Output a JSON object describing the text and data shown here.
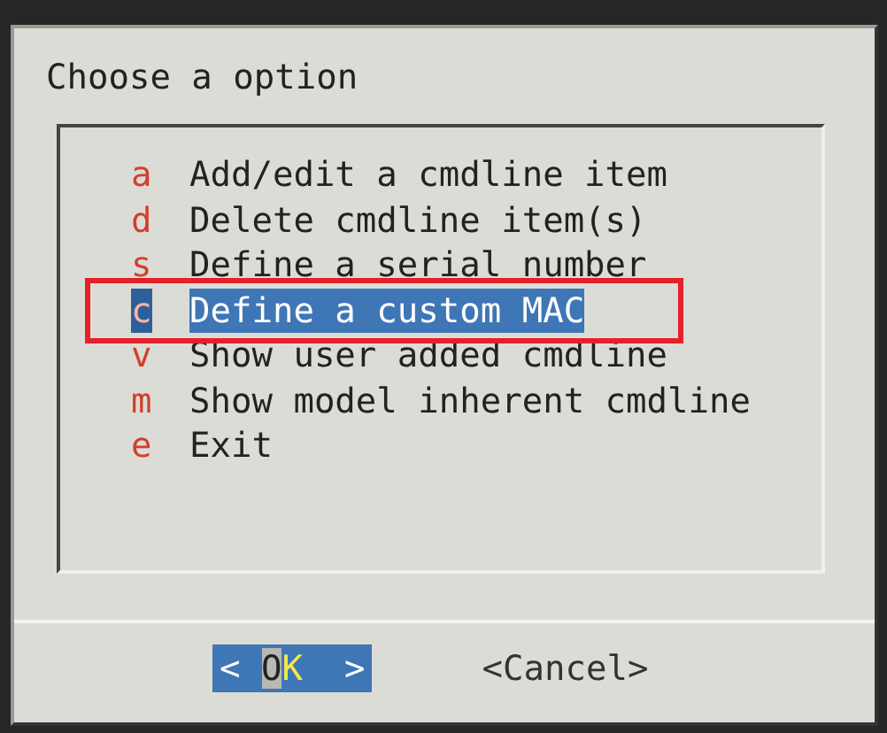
{
  "dialog": {
    "title": "Choose a option"
  },
  "menu_items": [
    {
      "key": "a",
      "label": "Add/edit a cmdline item",
      "selected": false,
      "annotated": false
    },
    {
      "key": "d",
      "label": "Delete cmdline item(s)",
      "selected": false,
      "annotated": false
    },
    {
      "key": "s",
      "label": "Define a serial number",
      "selected": false,
      "annotated": false
    },
    {
      "key": "c",
      "label": "Define a custom MAC",
      "selected": true,
      "annotated": true
    },
    {
      "key": "v",
      "label": "Show user added cmdline",
      "selected": false,
      "annotated": false
    },
    {
      "key": "m",
      "label": "Show model inherent cmdline",
      "selected": false,
      "annotated": false
    },
    {
      "key": "e",
      "label": "Exit",
      "selected": false,
      "annotated": false
    }
  ],
  "buttons": [
    {
      "left": "<",
      "label": "OK",
      "right": ">",
      "selected": true
    },
    {
      "left": "<",
      "label": "Cancel",
      "right": ">",
      "selected": false
    }
  ]
}
